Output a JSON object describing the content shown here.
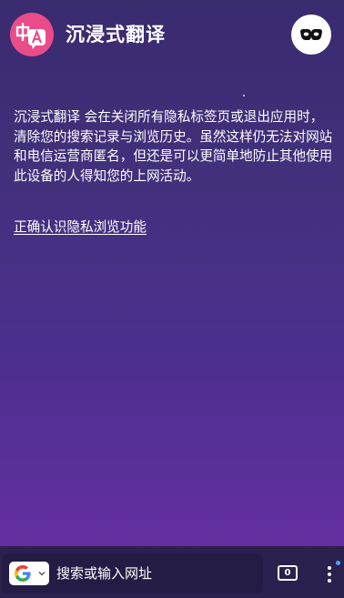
{
  "header": {
    "app_title": "沉浸式翻译",
    "logo_icon": "immersive-translate-logo",
    "logo_text": "中A",
    "incognito_icon": "incognito-mask-icon"
  },
  "main": {
    "description": "沉浸式翻译 会在关闭所有隐私标签页或退出应用时，清除您的搜索记录与浏览历史。虽然这样仍无法对网站和电信运营商匿名，但还是可以更简单地防止其他使用此设备的人得知您的上网活动。",
    "learn_more_link": "正确认识隐私浏览功能"
  },
  "bottom_bar": {
    "search_placeholder": "搜索或输入网址",
    "search_engine_icon": "google-icon",
    "tab_count": "0",
    "menu_icon": "more-vertical-icon"
  },
  "colors": {
    "background_top": "#3a2a6e",
    "background_bottom": "#6a2fa8",
    "logo_bg": "#ea4c89",
    "bar_bg": "#2b214f",
    "notify_dot": "#4fa3ff"
  }
}
